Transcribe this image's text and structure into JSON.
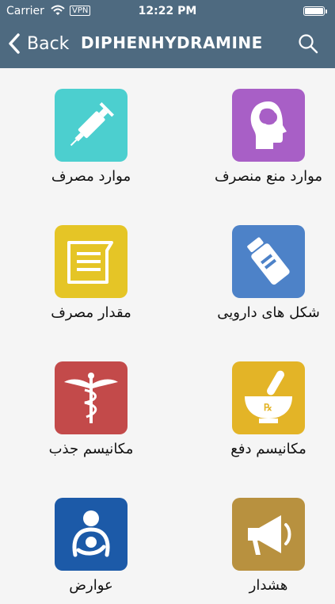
{
  "status_bar": {
    "carrier": "Carrier",
    "vpn": "VPN",
    "time": "12:22 PM",
    "icons": [
      "wifi-icon",
      "battery-icon"
    ]
  },
  "nav": {
    "back_label": "Back",
    "title": "DIPHENHYDRAMINE",
    "icons": [
      "chevron-left-icon",
      "search-icon"
    ]
  },
  "tiles": [
    {
      "label": "موارد مصرف",
      "icon": "syringe-icon",
      "color": "#4ccfcf"
    },
    {
      "label": "موارد منع منصرف",
      "icon": "head-brain-icon",
      "color": "#a85fc6"
    },
    {
      "label": "مقدار مصرف",
      "icon": "document-icon",
      "color": "#e5c526"
    },
    {
      "label": "شکل های دارویی",
      "icon": "pill-bottle-icon",
      "color": "#4d82c8"
    },
    {
      "label": "مکانیسم جذب",
      "icon": "caduceus-icon",
      "color": "#c34a4a"
    },
    {
      "label": "مکانیسم دفع",
      "icon": "mortar-pestle-icon",
      "color": "#e3b427"
    },
    {
      "label": "عوارض",
      "icon": "mother-child-icon",
      "color": "#1c5aa8"
    },
    {
      "label": "هشدار",
      "icon": "megaphone-icon",
      "color": "#b8913f"
    }
  ],
  "colors": {
    "header": "#4e6a80",
    "background": "#f5f5f5"
  }
}
